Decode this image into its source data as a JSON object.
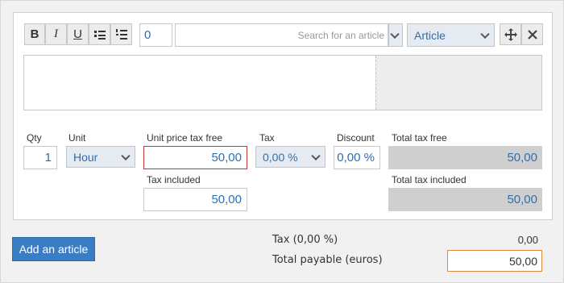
{
  "toolbar": {
    "bold_icon": "B",
    "italic_icon": "I",
    "underline_icon": "U",
    "quantity_value": "0",
    "search_placeholder": "Search for an article",
    "type_select": "Article"
  },
  "line": {
    "qty_label": "Qty",
    "qty_value": "1",
    "unit_label": "Unit",
    "unit_value": "Hour",
    "unit_price_label": "Unit price tax free",
    "unit_price_value": "50,00",
    "tax_label": "Tax",
    "tax_value": "0,00 %",
    "discount_label": "Discount",
    "discount_value": "0,00 %",
    "total_tax_free_label": "Total tax free",
    "total_tax_free_value": "50,00",
    "tax_included_label": "Tax included",
    "tax_included_value": "50,00",
    "total_tax_included_label": "Total tax included",
    "total_tax_included_value": "50,00"
  },
  "footer": {
    "add_article_label": "Add an article",
    "tax_summary_label": "Tax (0,00 %)",
    "tax_summary_value": "0,00",
    "total_payable_label": "Total payable (euros)",
    "total_payable_value": "50,00"
  },
  "colors": {
    "accent_blue": "#3b7dc4",
    "error_border": "#c0392b",
    "focus_border": "#d98c3a"
  }
}
